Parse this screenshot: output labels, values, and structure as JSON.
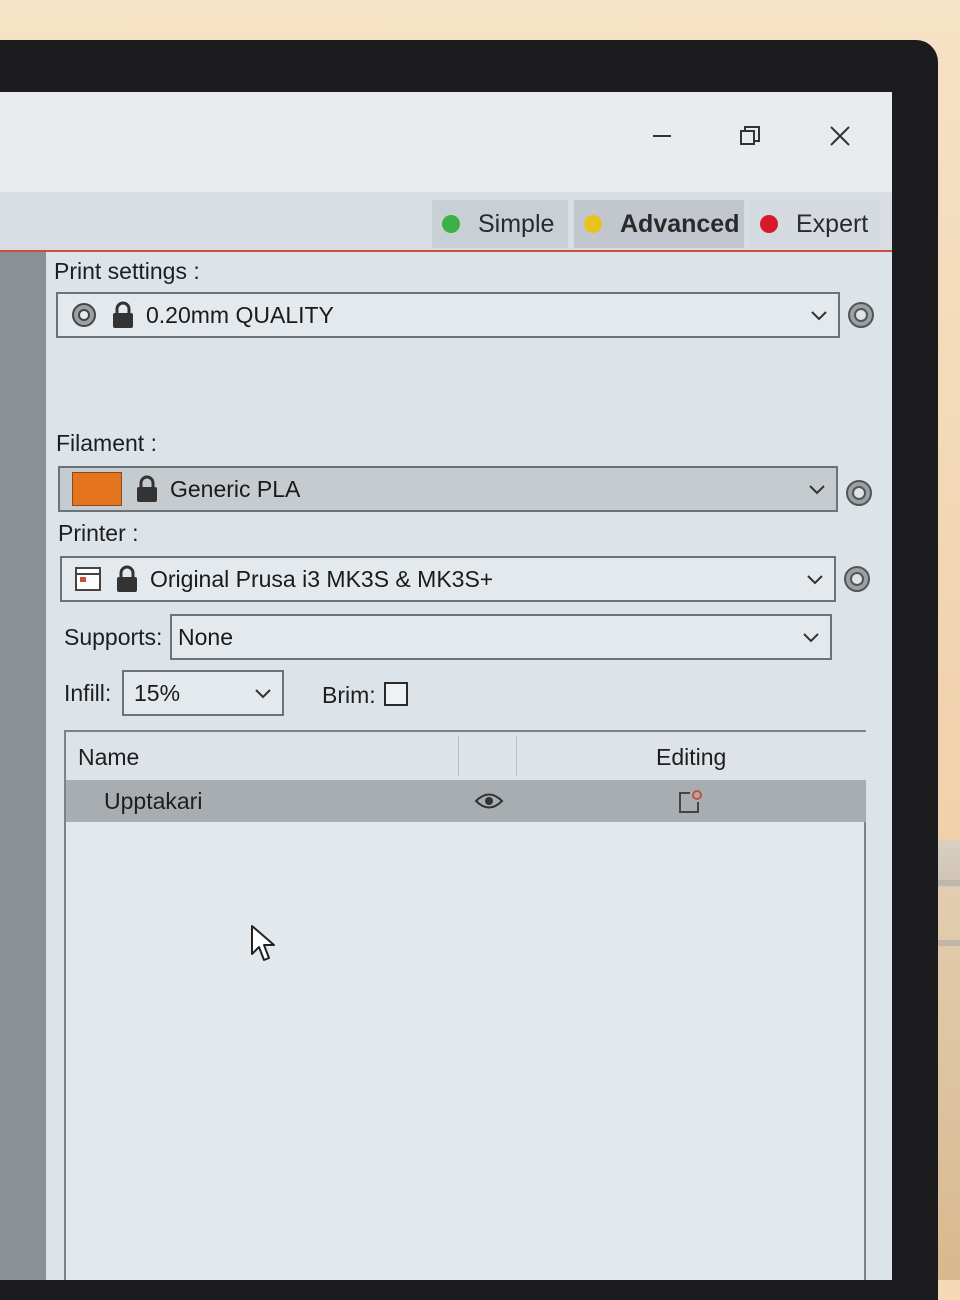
{
  "window_controls": {
    "minimize": "—",
    "maximize": "❐",
    "close": "✕"
  },
  "mode_tabs": [
    {
      "label": "Simple",
      "color": "#3db04a"
    },
    {
      "label": "Advanced",
      "color": "#e8c21f"
    },
    {
      "label": "Expert",
      "color": "#d8192a"
    }
  ],
  "print_settings": {
    "label": "Print settings :",
    "value": "0.20mm QUALITY"
  },
  "filament": {
    "label": "Filament :",
    "value": "Generic PLA",
    "swatch_color": "#e4741e"
  },
  "printer": {
    "label": "Printer :",
    "value": "Original Prusa i3 MK3S & MK3S+"
  },
  "supports": {
    "label": "Supports:",
    "value": "None"
  },
  "infill": {
    "label": "Infill:",
    "value": "15%"
  },
  "brim": {
    "label": "Brim:",
    "checked": false
  },
  "object_list": {
    "columns": [
      "Name",
      "",
      "Editing"
    ],
    "rows": [
      {
        "name": "Upptakari"
      }
    ]
  }
}
